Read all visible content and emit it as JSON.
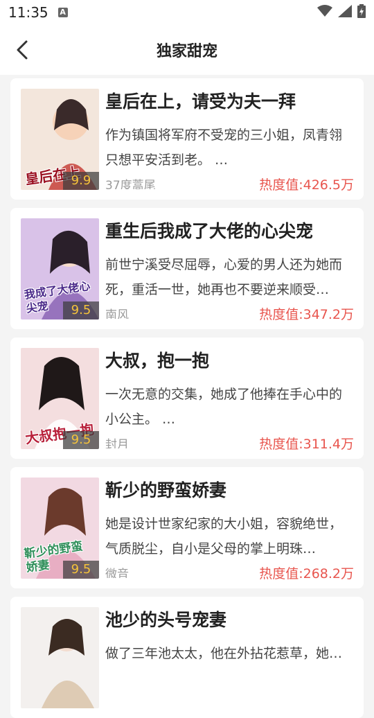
{
  "status": {
    "time": "11:35",
    "notify_glyph": "A"
  },
  "header": {
    "title": "独家甜宠"
  },
  "books": [
    {
      "title": "皇后在上，请受为夫一拜",
      "desc": "作为镇国将军府不受宠的三小姐，凤青翎只想平安活到老。 …",
      "author": "37度蒿尾",
      "heat": "热度值:426.5万",
      "score": "9.9",
      "cover_text": "皇后在上",
      "cover_colors": [
        "#f3e6dc",
        "#c6413a"
      ]
    },
    {
      "title": "重生后我成了大佬的心尖宠",
      "desc": "前世宁溪受尽屈辱，心爱的男人还为她而死，重活一世，她再也不要逆来顺受…",
      "author": "南风",
      "heat": "热度值:347.2万",
      "score": "9.5",
      "cover_text": "我成了大佬心尖宠",
      "cover_colors": [
        "#d9c2e8",
        "#6a3ea0"
      ]
    },
    {
      "title": "大叔，抱一抱",
      "desc": "一次无意的交集，她成了他捧在手心中的小公主。 …",
      "author": "封月",
      "heat": "热度值:311.4万",
      "score": "9.5",
      "cover_text": "大叔抱一抱",
      "cover_colors": [
        "#f4dedf",
        "#b8203a"
      ]
    },
    {
      "title": "靳少的野蛮娇妻",
      "desc": "她是设计世家纪家的大小姐，容貌绝世，气质脱尘，自小是父母的掌上明珠…",
      "author": "微音",
      "heat": "热度值:268.2万",
      "score": "9.5",
      "cover_text": "靳少的野蛮娇妻",
      "cover_colors": [
        "#f2d9e2",
        "#2f8f5a"
      ]
    },
    {
      "title": "池少的头号宠妻",
      "desc": "做了三年池太太，他在外拈花惹草，她…",
      "author": "",
      "heat": "",
      "score": "",
      "cover_text": "",
      "cover_colors": [
        "#f3f0ee",
        "#c9a57a"
      ]
    }
  ]
}
